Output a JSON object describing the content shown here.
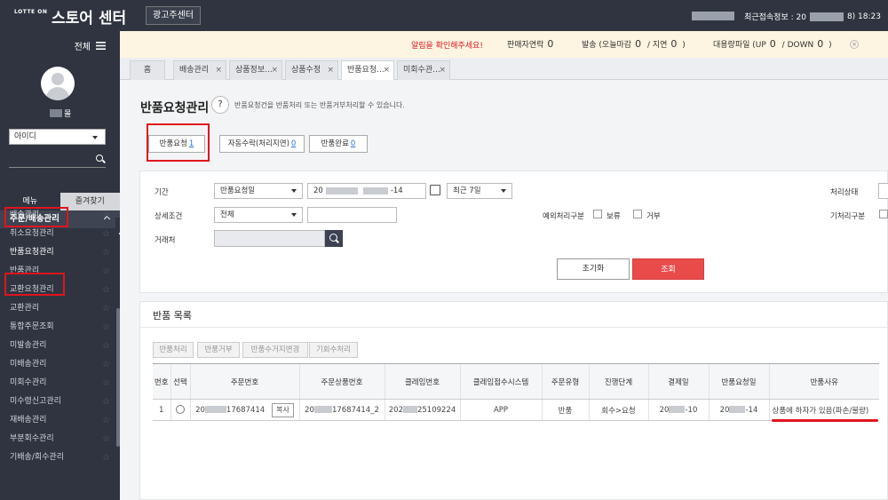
{
  "topbar": {
    "logo_small": "LOTTE ON",
    "logo_big": "스토어 센터",
    "ad_center": "광고주센터",
    "last_access_label": "최근접속정보 : 20",
    "last_access_suffix": "8) 18:23"
  },
  "sidebar": {
    "all_label": "전체",
    "user_suffix": "몰",
    "id_select": "아이디",
    "tab_menu": "메뉴",
    "tab_favorites": "즐겨찾기",
    "category": "주문/배송관리",
    "items": [
      {
        "label": "배송관리"
      },
      {
        "label": "취소요청관리"
      },
      {
        "label": "반품요청관리"
      },
      {
        "label": "반품관리"
      },
      {
        "label": "교환요청관리"
      },
      {
        "label": "교환관리"
      },
      {
        "label": "통합주문조회"
      },
      {
        "label": "미발송관리"
      },
      {
        "label": "미배송관리"
      },
      {
        "label": "미회수관리"
      },
      {
        "label": "미수령신고관리"
      },
      {
        "label": "재배송관리"
      },
      {
        "label": "부분회수관리"
      },
      {
        "label": "기배송/회수관리"
      }
    ]
  },
  "notice": {
    "alert": "알림을 확인해주세요!",
    "seller_contact": "판매자연락",
    "seller_contact_count": "0",
    "shipping_label": "발송 (오늘마감",
    "shipping_count": "0",
    "delay_label": "/ 지연",
    "delay_count": "0",
    "delay_close": ")",
    "bulk_label": "대용량파일 (UP",
    "bulk_up": "0",
    "bulk_down_label": "/ DOWN",
    "bulk_down": "0",
    "bulk_close": ")",
    "close_icon": "×"
  },
  "tabs": [
    {
      "label": "홈"
    },
    {
      "label": "배송관리"
    },
    {
      "label": "상품정보..."
    },
    {
      "label": "상품수정"
    },
    {
      "label": "반품요청..."
    },
    {
      "label": "미회수관..."
    }
  ],
  "page": {
    "title": "반품요청관리",
    "help": "?",
    "description": "반품요청건을 반품처리 또는 반품거부처리할 수 있습니다."
  },
  "subtabs": [
    {
      "label": "반품요청",
      "count": "1"
    },
    {
      "label": "자동수락(처리지연)",
      "count": "0"
    },
    {
      "label": "반품완료",
      "count": "0"
    }
  ],
  "filter": {
    "period_label": "기간",
    "period_type": "반품요청일",
    "date_prefix": "20",
    "date_suffix": "-14",
    "range": "최근 7일",
    "status_label": "처리상태",
    "detail_label": "상세조건",
    "detail_value": "전체",
    "exception_label": "예외처리구분",
    "hold_label": "보류",
    "reject_label": "거부",
    "preprocess_label": "기처리구분",
    "vendor_label": "거래처",
    "reset_button": "초기화",
    "search_button": "조회"
  },
  "list": {
    "title": "반품 목록",
    "actions": [
      "반품처리",
      "반품거부",
      "반품수거지변경",
      "기회수처리"
    ],
    "columns": [
      "번호",
      "선택",
      "주문번호",
      "주문상품번호",
      "클레임번호",
      "클레임접수시스템",
      "주문유형",
      "진행단계",
      "결제일",
      "반품요청일",
      "반품사유"
    ],
    "rows": [
      {
        "no": "1",
        "order_prefix": "20",
        "order_suffix": "17687414",
        "copy": "복사",
        "product_prefix": "20",
        "product_suffix": "17687414_2",
        "claim_prefix": "202",
        "claim_suffix": "25109224",
        "system": "APP",
        "type": "반품",
        "stage": "회수>요청",
        "pay_prefix": "20",
        "pay_suffix": "-10",
        "req_prefix": "20",
        "req_suffix": "-14",
        "reason": "상품에 하자가 있음(파손/불량)"
      }
    ]
  }
}
